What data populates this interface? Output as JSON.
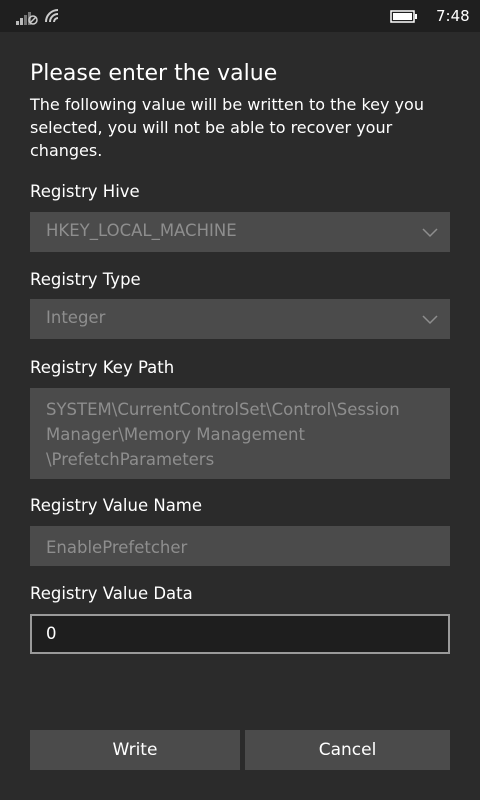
{
  "status_bar": {
    "time": "7:48",
    "icons": [
      "signal-icon",
      "wifi-icon",
      "battery-icon"
    ]
  },
  "dialog": {
    "title": "Please enter the value",
    "description": "The following value will be written to the key you selected, you will not be able to recover your changes.",
    "hive": {
      "label": "Registry Hive",
      "value": "HKEY_LOCAL_MACHINE"
    },
    "type": {
      "label": "Registry Type",
      "value": "Integer"
    },
    "key_path": {
      "label": "Registry Key Path",
      "value": "SYSTEM\\CurrentControlSet\\Control\\Session Manager\\Memory Management \\PrefetchParameters"
    },
    "value_name": {
      "label": "Registry Value Name",
      "value": "EnablePrefetcher"
    },
    "value_data": {
      "label": "Registry Value Data",
      "value": "0"
    },
    "buttons": {
      "write": "Write",
      "cancel": "Cancel"
    }
  },
  "colors": {
    "background": "#2b2b2b",
    "field": "#4b4b4b",
    "disabled_text": "#8e8e8e",
    "active_field": "#1e1e1e"
  }
}
